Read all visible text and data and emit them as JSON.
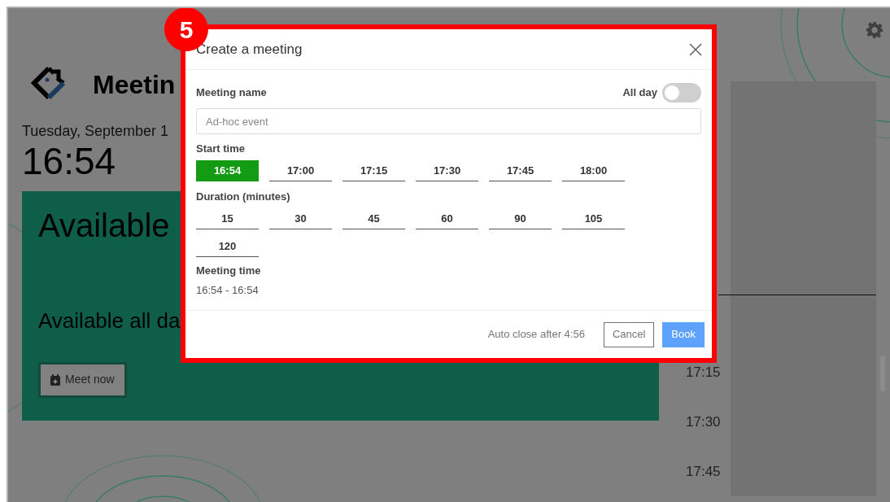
{
  "app": {
    "title": "Meetin",
    "date": "Tuesday, September 1",
    "clock": "16:54"
  },
  "status_card": {
    "status": "Available",
    "detail": "Available all da",
    "action": "Meet now"
  },
  "timeline": {
    "times": [
      "17:15",
      "17:30",
      "17:45"
    ]
  },
  "dialog": {
    "step_badge": "5",
    "title": "Create a meeting",
    "name_label": "Meeting name",
    "name_placeholder": "Ad-hoc event",
    "all_day": {
      "label": "All day",
      "on": false
    },
    "start_label": "Start time",
    "start_options": [
      {
        "label": "16:54",
        "selected": true
      },
      {
        "label": "17:00",
        "selected": false
      },
      {
        "label": "17:15",
        "selected": false
      },
      {
        "label": "17:30",
        "selected": false
      },
      {
        "label": "17:45",
        "selected": false
      },
      {
        "label": "18:00",
        "selected": false
      }
    ],
    "duration_label": "Duration (minutes)",
    "duration_options": [
      {
        "label": "15",
        "selected": false
      },
      {
        "label": "30",
        "selected": false
      },
      {
        "label": "45",
        "selected": false
      },
      {
        "label": "60",
        "selected": false
      },
      {
        "label": "90",
        "selected": false
      },
      {
        "label": "105",
        "selected": false
      },
      {
        "label": "120",
        "selected": false
      }
    ],
    "meeting_time_label": "Meeting time",
    "meeting_time": "16:54 - 16:54",
    "auto_close": "Auto close after 4:56",
    "buttons": [
      {
        "label": "Cancel",
        "kind": "secondary"
      },
      {
        "label": "Book",
        "kind": "primary"
      }
    ]
  }
}
